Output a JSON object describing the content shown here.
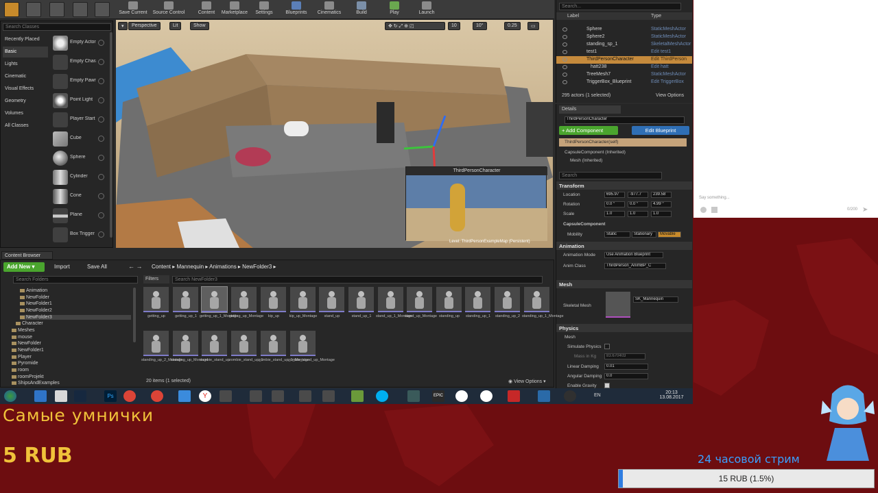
{
  "toolbar": {
    "buttons": [
      "Save Current",
      "Source Control",
      "Content",
      "Marketplace",
      "Settings",
      "Blueprints",
      "Cinematics",
      "Build",
      "Play",
      "Launch"
    ]
  },
  "place_panel": {
    "search_placeholder": "Search Classes",
    "categories": [
      "Recently Placed",
      "Basic",
      "Lights",
      "Cinematic",
      "Visual Effects",
      "Geometry",
      "Volumes",
      "All Classes"
    ],
    "selected_category": "Basic",
    "items": [
      "Empty Actor",
      "Empty Character",
      "Empty Pawn",
      "Point Light",
      "Player Start",
      "Cube",
      "Sphere",
      "Cylinder",
      "Cone",
      "Plane",
      "Box Trigger"
    ]
  },
  "viewport": {
    "perspective": "Perspective",
    "lit": "Lit",
    "show": "Show",
    "grid_snap": "10",
    "rot_snap": "10°",
    "scale_snap": "0.25",
    "pip_title": "ThirdPersonCharacter",
    "level_label": "Level: ThirdPersonExampleMap (Persistent)"
  },
  "outliner": {
    "search_placeholder": "Search...",
    "col_label": "Label",
    "col_type": "Type",
    "rows": [
      {
        "name": "Sphere",
        "type": "StaticMeshActor"
      },
      {
        "name": "Sphere2",
        "type": "StaticMeshActor"
      },
      {
        "name": "standing_sp_1",
        "type": "SkeletalMeshActor"
      },
      {
        "name": "test1",
        "type": "Edit test1"
      },
      {
        "name": "ThirdPersonCharacter",
        "type": "Edit ThirdPerson"
      },
      {
        "name": "hatt238",
        "type": "Edit hatt"
      },
      {
        "name": "TreeMesh7",
        "type": "StaticMeshActor"
      },
      {
        "name": "TriggerBox_Blueprint",
        "type": "Edit TriggerBox"
      }
    ],
    "selected_row": "ThirdPersonCharacter",
    "count": "295 actors (1 selected)",
    "view_options": "View Options"
  },
  "details": {
    "tab": "Details",
    "name": "ThirdPersonCharacter",
    "add_component": "+ Add Component",
    "edit_blueprint": "Edit Blueprint",
    "self": "ThirdPersonCharacter(self)",
    "components": [
      "CapsuleComponent (Inherited)",
      "Mesh (Inherited)"
    ],
    "search_placeholder": "Search",
    "transform": "Transform",
    "location_label": "Location",
    "location": [
      "695.97",
      "-977.7",
      "239.58"
    ],
    "rotation_label": "Rotation",
    "rotation": [
      "0.0 °",
      "0.0 °",
      "4.99 °"
    ],
    "scale_label": "Scale",
    "scale": [
      "1.0",
      "1.0",
      "1.0"
    ],
    "capsule": "CapsuleComponent",
    "mobility_label": "Mobility",
    "mobility": [
      "Static",
      "Stationary",
      "Movable"
    ],
    "animation": "Animation",
    "anim_mode_label": "Animation Mode",
    "anim_mode": "Use Animation Blueprint",
    "anim_class_label": "Anim Class",
    "anim_class": "ThirdPerson_AnimBP_C",
    "mesh": "Mesh",
    "skeletal_mesh_label": "Skeletal Mesh",
    "skeletal_mesh": "SK_Mannequin",
    "physics": "Physics",
    "mesh_sub": "Mesh",
    "simulate_label": "Simulate Physics",
    "mass_label": "Mass in Kg",
    "mass": "83.670403",
    "lin_damp_label": "Linear Damping",
    "lin_damp": "0.01",
    "ang_damp_label": "Angular Damping",
    "ang_damp": "0.0",
    "gravity_label": "Enable Gravity"
  },
  "content_browser": {
    "tab": "Content Browser",
    "add_new": "Add New",
    "import": "Import",
    "save_all": "Save All",
    "path": [
      "Content",
      "Mannequin",
      "Animations",
      "NewFolder3"
    ],
    "search_folders": "Search Folders",
    "filters": "Filters",
    "search_assets": "Search NewFolder3",
    "folders": [
      "Animation",
      "NewFolder",
      "NewFolder1",
      "NewFolder2",
      "NewFolder3",
      "Character",
      "Meshes",
      "mouse",
      "NewFolder",
      "NewFolder1",
      "Player",
      "Pyromide",
      "room",
      "roomProjekt",
      "ShipsAndExamples"
    ],
    "assets": [
      "getting_up",
      "getting_up_1",
      "getting_up_1_Montage",
      "getting_up_Montage",
      "kip_up",
      "kip_up_Montage",
      "stand_up",
      "stand_up_1",
      "stand_up_1_Montage",
      "stand_up_Montage",
      "standing_up",
      "standing_up_1",
      "standing_up_2",
      "standing_up_1_Montage",
      "standing_up_2_Montage",
      "standing_up_Montage",
      "zombie_stand_up",
      "zombie_stand_up_1",
      "zombie_stand_up_1_Montage",
      "zombie_stand_up_Montage"
    ],
    "selected_asset": "getting_up_1_Montage",
    "count": "20 items (1 selected)",
    "view_options": "View Options"
  },
  "taskbar": {
    "time": "20:13",
    "date": "13.08.2017",
    "lang": "EN"
  },
  "chat": {
    "placeholder": "Say something...",
    "counter": "0/200"
  },
  "overlay": {
    "donor": "Самые  умнички",
    "amount": "5 RUB",
    "goal_title": "24 часовой стрим",
    "goal_text": "15 RUB (1.5%)",
    "goal_fraction": 0.015
  },
  "colors": {
    "accent": "#c58a3c",
    "add_new": "#4aa52e",
    "edit_blueprint": "#2f6fb5",
    "overlay_text": "#f0c23a",
    "goal_title": "#3aa0ff",
    "goal_fill": "#2f7de1",
    "background": "#6d0d10"
  }
}
